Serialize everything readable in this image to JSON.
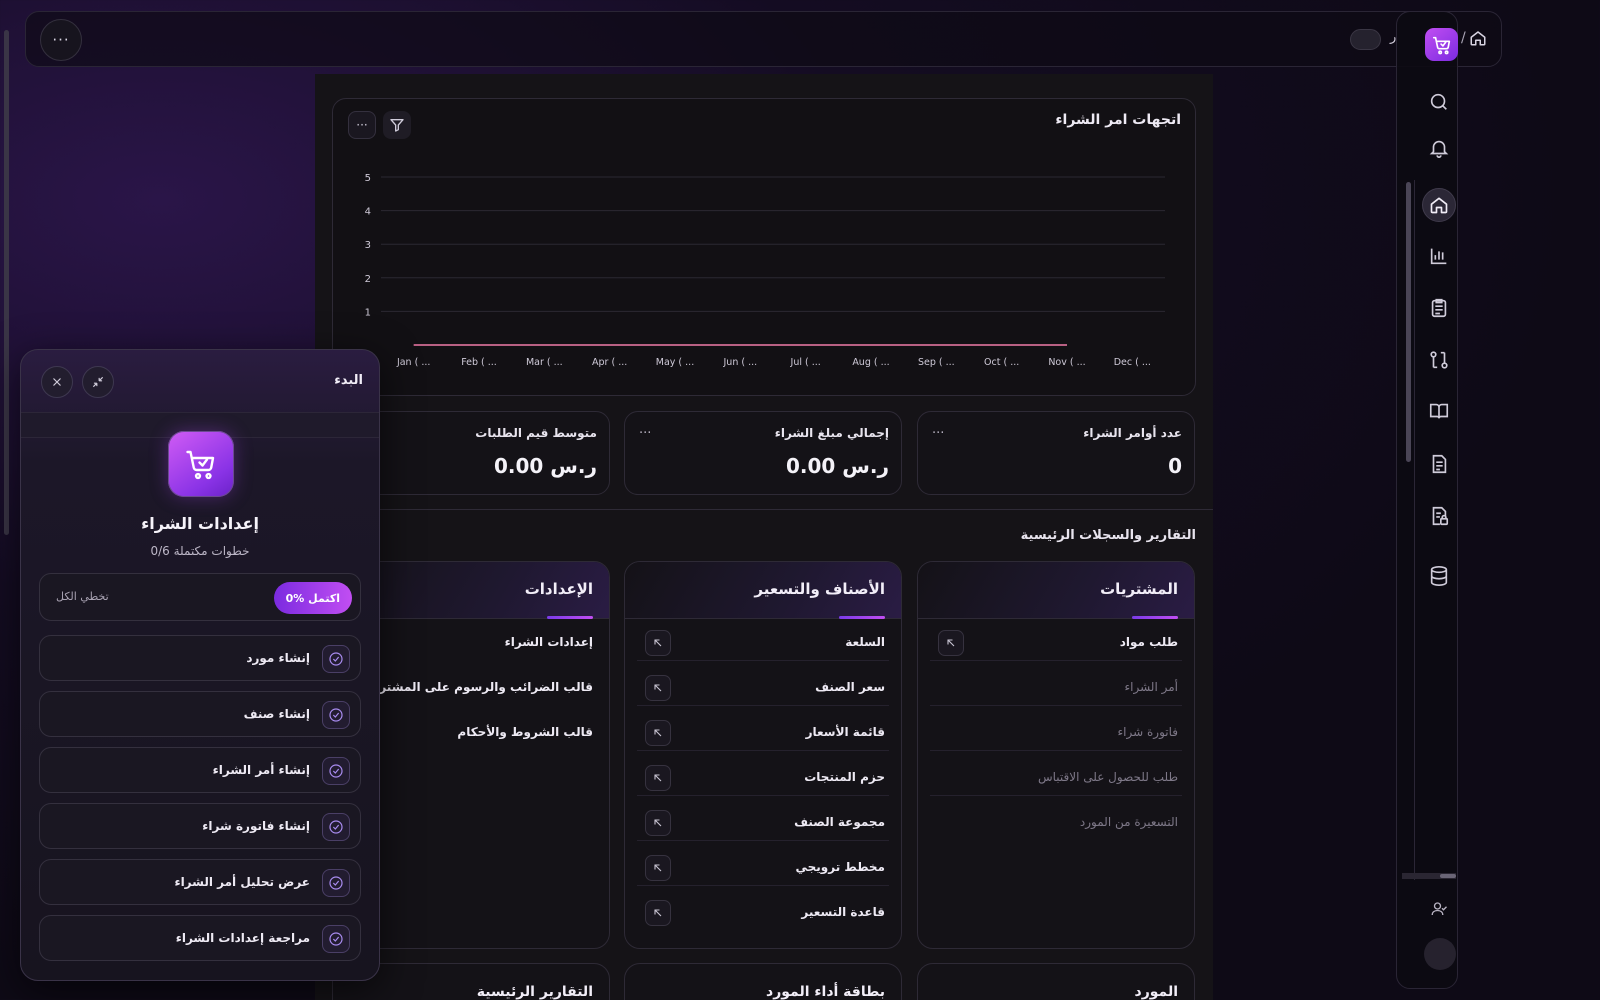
{
  "topbar": {
    "more_label": "···",
    "truncated_text": "ر",
    "breadcrumb_sep": "/"
  },
  "chart": {
    "title": "اتجهات امر الشراء",
    "more_label": "···"
  },
  "chart_data": {
    "type": "line",
    "title": "اتجهات امر الشراء",
    "categories": [
      "Jan ( ...",
      "Feb ( ...",
      "Mar ( ...",
      "Apr ( ...",
      "May ( ...",
      "Jun ( ...",
      "Jul ( ...",
      "Aug ( ...",
      "Sep ( ...",
      "Oct ( ...",
      "Nov ( ...",
      "Dec ( ..."
    ],
    "series": [
      {
        "values": [
          0,
          0,
          0,
          0,
          0,
          0,
          0,
          0,
          0,
          0,
          0,
          null
        ],
        "color": "#f07aa8"
      }
    ],
    "yticks": [
      1,
      2,
      3,
      4,
      5
    ],
    "ylim": [
      0,
      5
    ],
    "grid": true
  },
  "stats": [
    {
      "label": "عدد أوامر الشراء",
      "value": "0",
      "dots": "···"
    },
    {
      "label": "إجمالي مبلغ الشراء",
      "value": "0.00 ر.س",
      "dots": "···"
    },
    {
      "label": "متوسط قيم الطلبات",
      "value": "0.00 ر.س"
    }
  ],
  "section_title": "التقارير والسجلات الرئيسية",
  "cards": [
    {
      "title": "المشتريات",
      "items": [
        {
          "label": "طلب مواد",
          "dim": false,
          "link": true
        },
        {
          "label": "أمر الشراء",
          "dim": true,
          "link": false
        },
        {
          "label": "فاتورة شراء",
          "dim": true,
          "link": false
        },
        {
          "label": "طلب للحصول على الاقتباس",
          "dim": true,
          "link": false
        },
        {
          "label": "التسعيرة من المورد",
          "dim": true,
          "link": false
        }
      ]
    },
    {
      "title": "الأصناف والتسعير",
      "items": [
        {
          "label": "السلعة",
          "link": true
        },
        {
          "label": "سعر الصنف",
          "link": true
        },
        {
          "label": "قائمة الأسعار",
          "link": true
        },
        {
          "label": "حزم المنتجات",
          "link": true
        },
        {
          "label": "مجموعة الصنف",
          "link": true
        },
        {
          "label": "مخطط ترويجي",
          "link": true
        },
        {
          "label": "قاعدة التسعير",
          "link": true
        }
      ]
    },
    {
      "title": "الإعدادات",
      "items": [
        {
          "label": "إعدادات الشراء"
        },
        {
          "label": "قالب الضرائب والرسوم على المشتريات"
        },
        {
          "label": "قالب الشروط والأحكام"
        }
      ]
    }
  ],
  "bottom_cards": [
    "المورد",
    "بطاقة أداء المورد",
    "التقارير الرئيسية"
  ],
  "getting_started": {
    "title": "البدء",
    "heading": "إعدادات الشراء",
    "subheading": "0/6 خطوات مكتملة",
    "progress_badge": "0% اكتمل",
    "skip_all": "تخطي الكل",
    "steps": [
      "إنشاء مورد",
      "إنشاء صنف",
      "إنشاء أمر الشراء",
      "إنشاء فاتورة شراء",
      "عرض تحليل أمر الشراء",
      "مراجعة إعدادات الشراء"
    ]
  }
}
